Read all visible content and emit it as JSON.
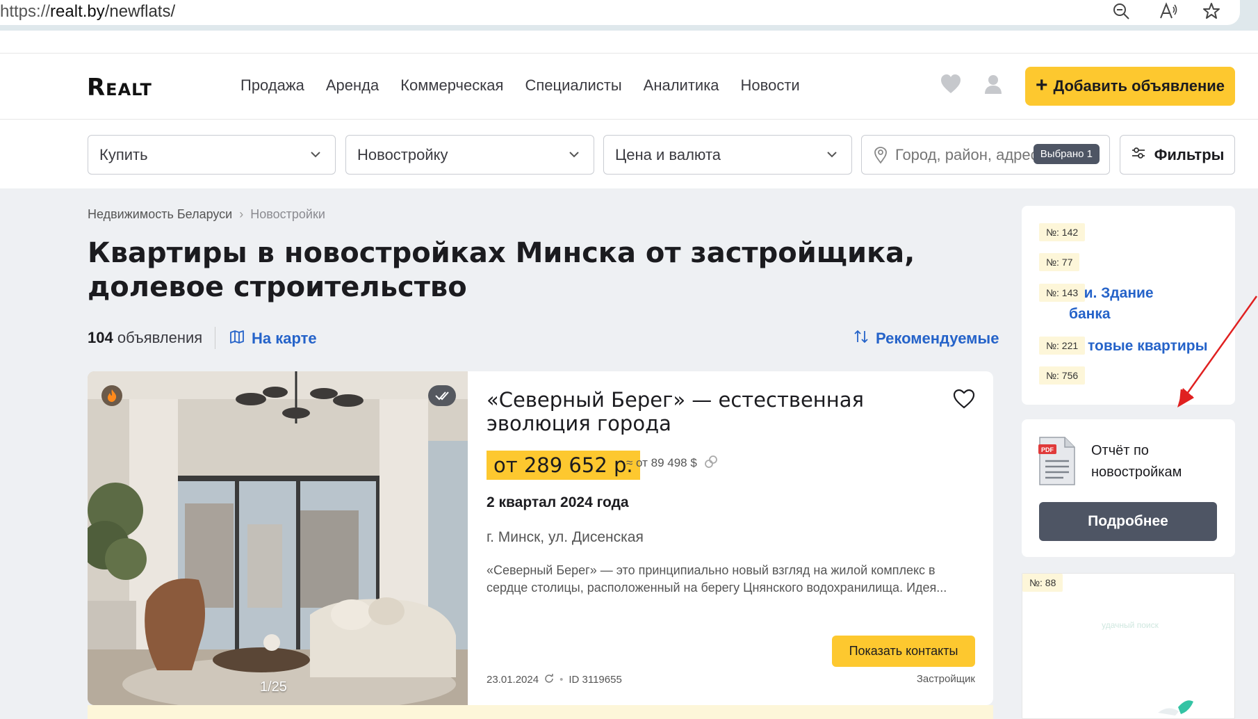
{
  "browser": {
    "url_prefix": "https://",
    "url_host": "realt.by",
    "url_path": "/newflats/"
  },
  "header": {
    "logo": "Realt",
    "nav": [
      "Продажа",
      "Аренда",
      "Коммерческая",
      "Специалисты",
      "Аналитика",
      "Новости"
    ],
    "add_button": "Добавить объявление",
    "add_plus": "+"
  },
  "search": {
    "deal_type": "Купить",
    "property_type": "Новостройку",
    "price": "Цена и валюта",
    "location_placeholder": "Город, район, адрес",
    "location_chip": "Выбрано 1",
    "filters": "Фильтры"
  },
  "breadcrumb": {
    "root": "Недвижимость Беларуси",
    "current": "Новостройки"
  },
  "page": {
    "title": "Квартиры в новостройках Минска от застройщика, долевое строительство",
    "count_number": "104",
    "count_label": "объявления",
    "map_link": "На карте",
    "sort_link": "Рекомендуемые"
  },
  "listing": {
    "title": "«Северный Берег» — естественная эволюция города",
    "price": "от 289 652 р.",
    "price_usd": "≈ от 89 498 $",
    "term": "2 квартал 2024 года",
    "address": "г. Минск, ул. Дисенская",
    "description": "«Северный Берег» — это принципиально новый взгляд на жилой комплекс в сердце столицы, расположенный на берегу Цнянского водохранилища. Идея...",
    "contacts_button": "Показать контакты",
    "date": "23.01.2024",
    "id": "ID 3119655",
    "developer": "Застройщик",
    "image_counter": "1/25"
  },
  "sidebar": {
    "tags": [
      "№: 142",
      "№: 77",
      "№: 143",
      "№: 221",
      "№: 756"
    ],
    "link1_line1": "рги. Здание",
    "link1_line2": "банка",
    "link2": "товые квартиры",
    "report_title": "Отчёт по новостройкам",
    "more_button": "Подробнее",
    "ad_tag": "№: 88",
    "ad_text": "удачный поиск"
  },
  "colors": {
    "accent_yellow": "#fdc82f",
    "link_blue": "#2563c9",
    "dark_button": "#4e5564",
    "annotation_red": "#e02020"
  }
}
